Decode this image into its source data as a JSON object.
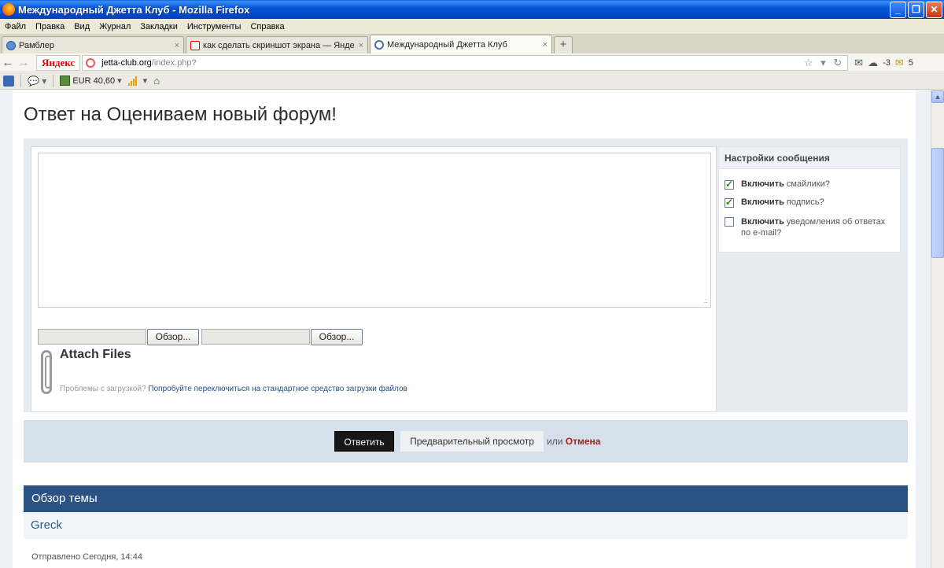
{
  "window": {
    "title": "Международный Джетта Клуб - Mozilla Firefox",
    "buttons": [
      "_",
      "❐",
      "✕"
    ]
  },
  "menu": [
    "Файл",
    "Правка",
    "Вид",
    "Журнал",
    "Закладки",
    "Инструменты",
    "Справка"
  ],
  "tabs": [
    {
      "label": "Рамблер",
      "icon": "rambler-icon",
      "close": "×"
    },
    {
      "label": "как сделать скриншот экрана — Янде...",
      "icon": "yandex-icon",
      "close": "×"
    },
    {
      "label": "Международный Джетта Клуб",
      "icon": "vw-icon",
      "close": "×"
    }
  ],
  "new_tab_label": "+",
  "nav": {
    "yandex": "Яндекс",
    "url_host": "jetta-club.org",
    "url_path": "/index.php?",
    "extras": {
      "weather": "-3",
      "mail_count": "5"
    }
  },
  "toolbar": {
    "currency": "EUR 40,60"
  },
  "page": {
    "title": "Ответ на Оцениваем новый форум!",
    "file_inputs": [
      {
        "browse_label": "Обзор..."
      },
      {
        "browse_label": "Обзор..."
      }
    ],
    "attach": {
      "title": "Attach Files",
      "hint": "Проблемы с загрузкой?",
      "hint_link": "Попробуйте переключиться на стандартное средство загрузки файлов"
    },
    "settings": {
      "title": "Настройки сообщения",
      "options": [
        {
          "bold": "Включить",
          "rest": " смайлики?",
          "checked": true
        },
        {
          "bold": "Включить",
          "rest": " подпись?",
          "checked": true
        },
        {
          "bold": "Включить",
          "rest": " уведомления об ответах по e-mail?",
          "checked": false
        }
      ]
    },
    "actions": {
      "reply": "Ответить",
      "preview": "Предварительный просмотр",
      "or": "или",
      "cancel": "Отмена"
    },
    "topic": {
      "header": "Обзор темы",
      "author": "Greck",
      "meta": "Отправлено Сегодня, 14:44"
    }
  },
  "colors": {
    "accent": "#2a5282",
    "cancel": "#b31b1b",
    "brand_button": "#171717"
  }
}
